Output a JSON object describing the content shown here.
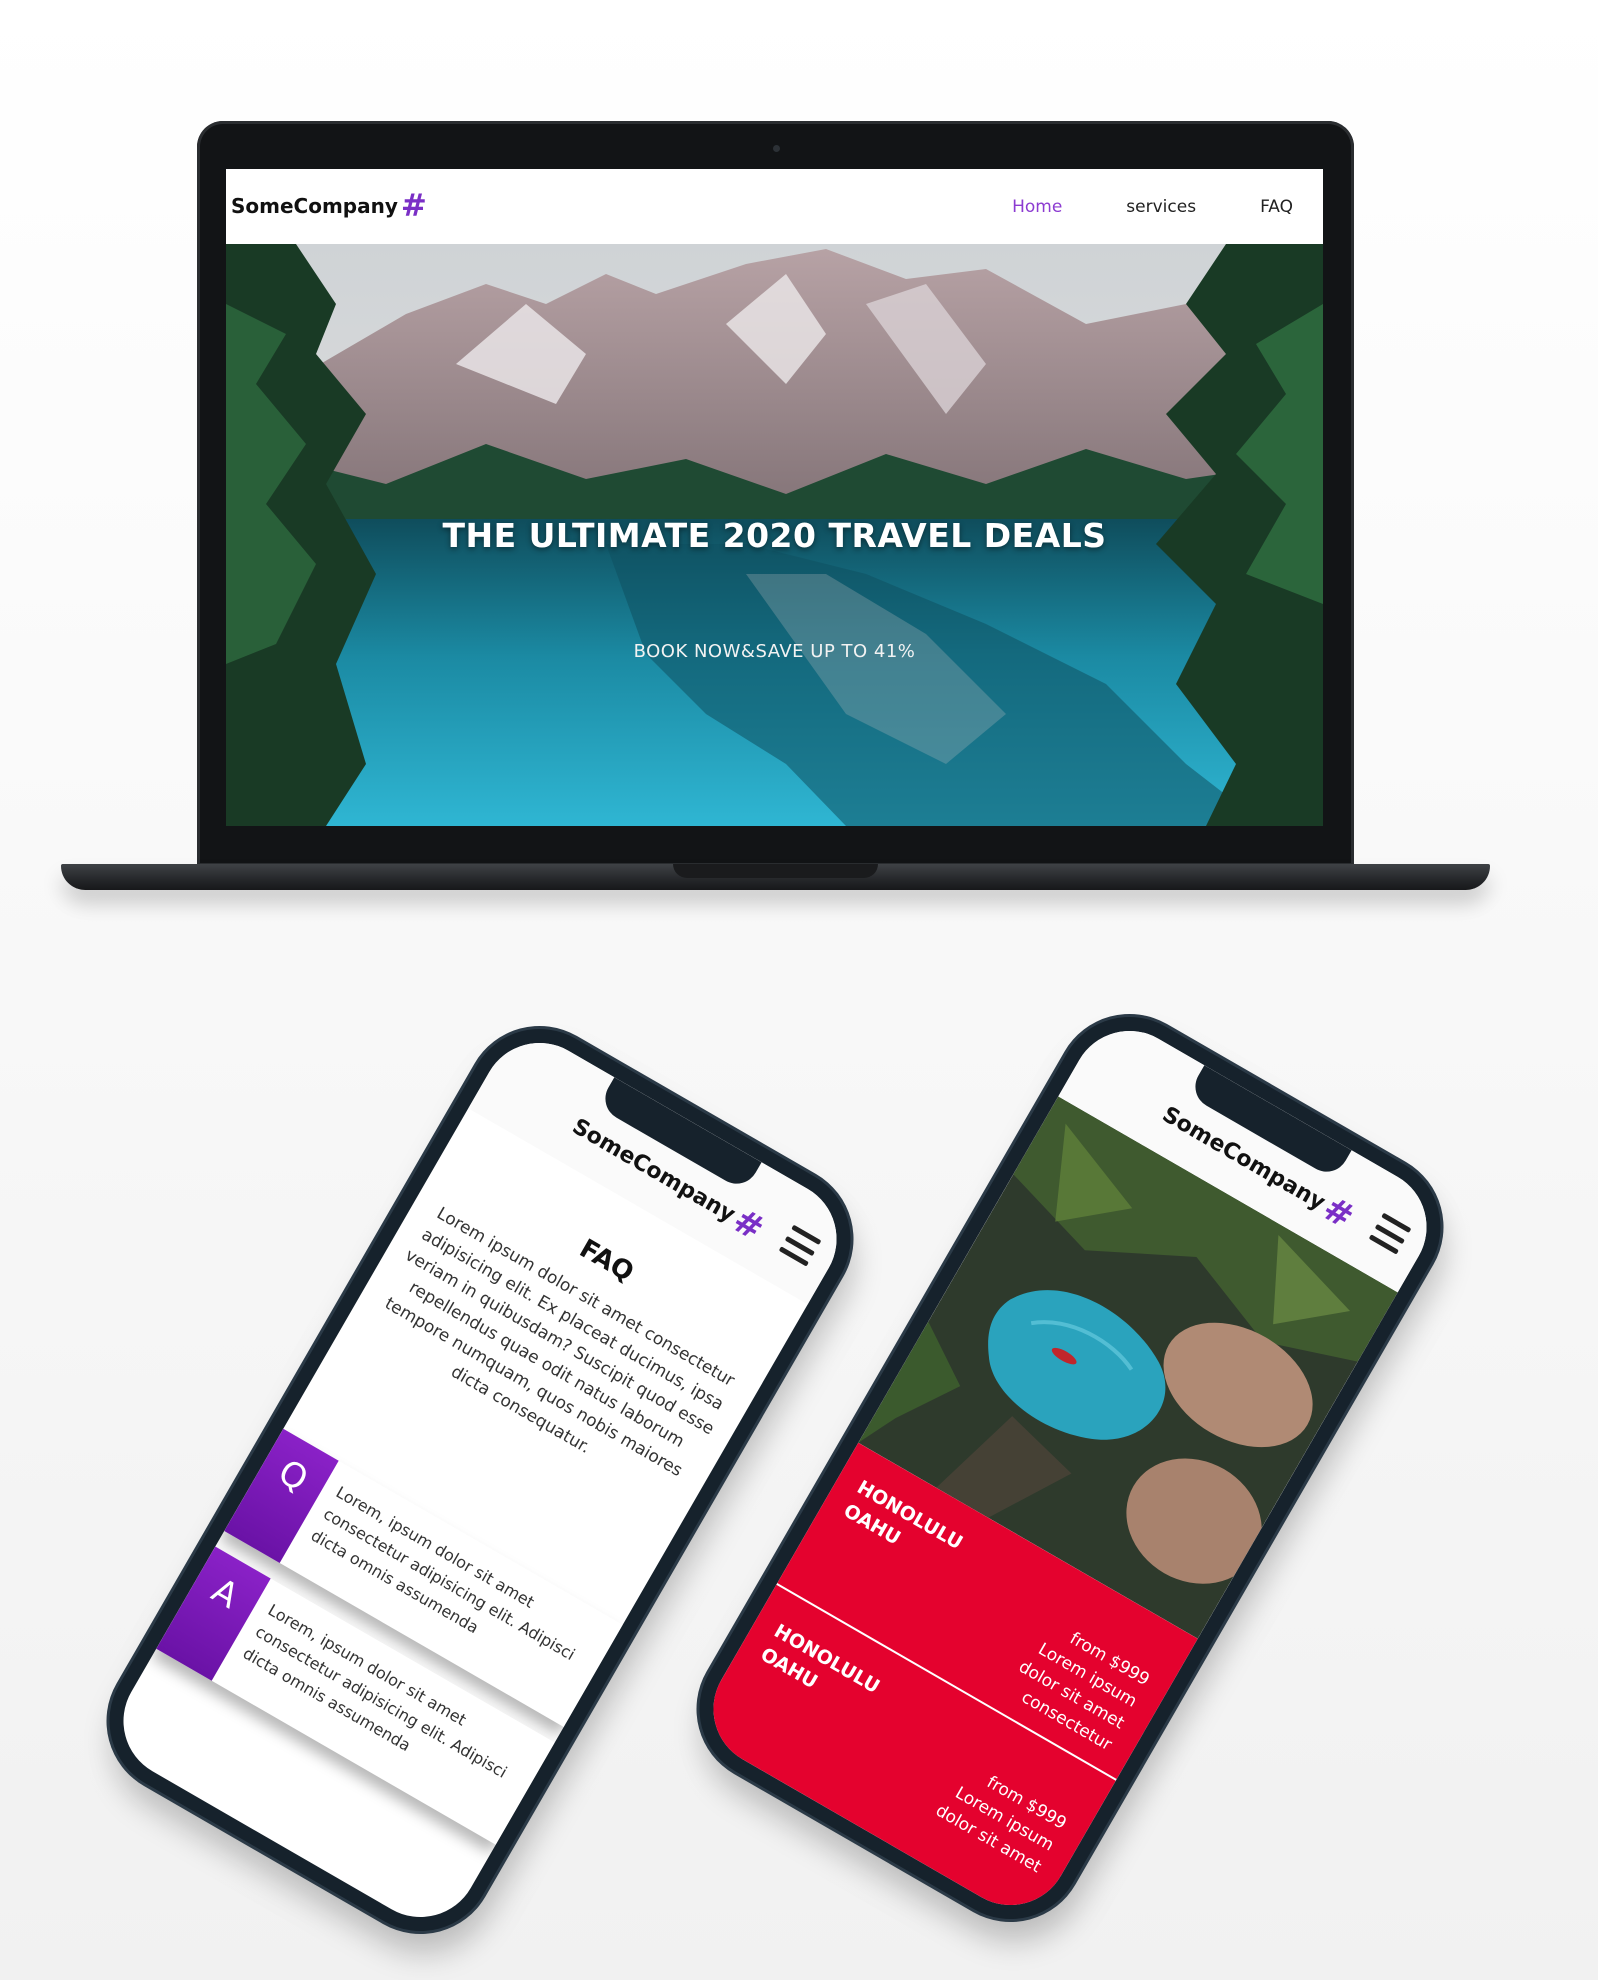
{
  "desktop": {
    "brand": {
      "name": "SomeCompany",
      "icon": "hash-icon"
    },
    "nav": {
      "items": [
        {
          "label": "Home",
          "active": true
        },
        {
          "label": "services",
          "active": false
        },
        {
          "label": "FAQ",
          "active": false
        }
      ]
    },
    "hero": {
      "title": "THE ULTIMATE 2020 TRAVEL DEALS",
      "subtitle": "BOOK NOW&SAVE UP TO 41%"
    }
  },
  "mobile_faq": {
    "brand": {
      "name": "SomeCompany",
      "icon": "hash-icon"
    },
    "title": "FAQ",
    "intro": "Lorem ipsum dolor sit amet consectetur adipisicing elit. Ex placeat ducimus, ipsa veriam in quibusdam? Suscipit quod esse repellendus quae odit natus laborum tempore numquam, quos nobis maiores dicta consequatur.",
    "qa": [
      {
        "badge": "Q",
        "text": "Lorem, ipsum dolor sit amet consectetur adipisicing elit. Adipisci dicta omnis assumenda"
      },
      {
        "badge": "A",
        "text": "Lorem, ipsum dolor sit amet consectetur adipisicing elit. Adipisci dicta omnis assumenda"
      }
    ]
  },
  "mobile_deals": {
    "brand": {
      "name": "SomeCompany",
      "icon": "hash-icon"
    },
    "deals": [
      {
        "city": "HONOLULU\nOAHU",
        "price": "from $999",
        "desc": "Lorem ipsum dolor sit amet consectetur"
      },
      {
        "city": "HONOLULU\nOAHU",
        "price": "from $999",
        "desc": "Lorem ipsum dolor sit amet"
      }
    ]
  },
  "colors": {
    "accent_purple": "#7a2fc6",
    "deals_red": "#e4022e",
    "device_frame": "#16222c"
  }
}
